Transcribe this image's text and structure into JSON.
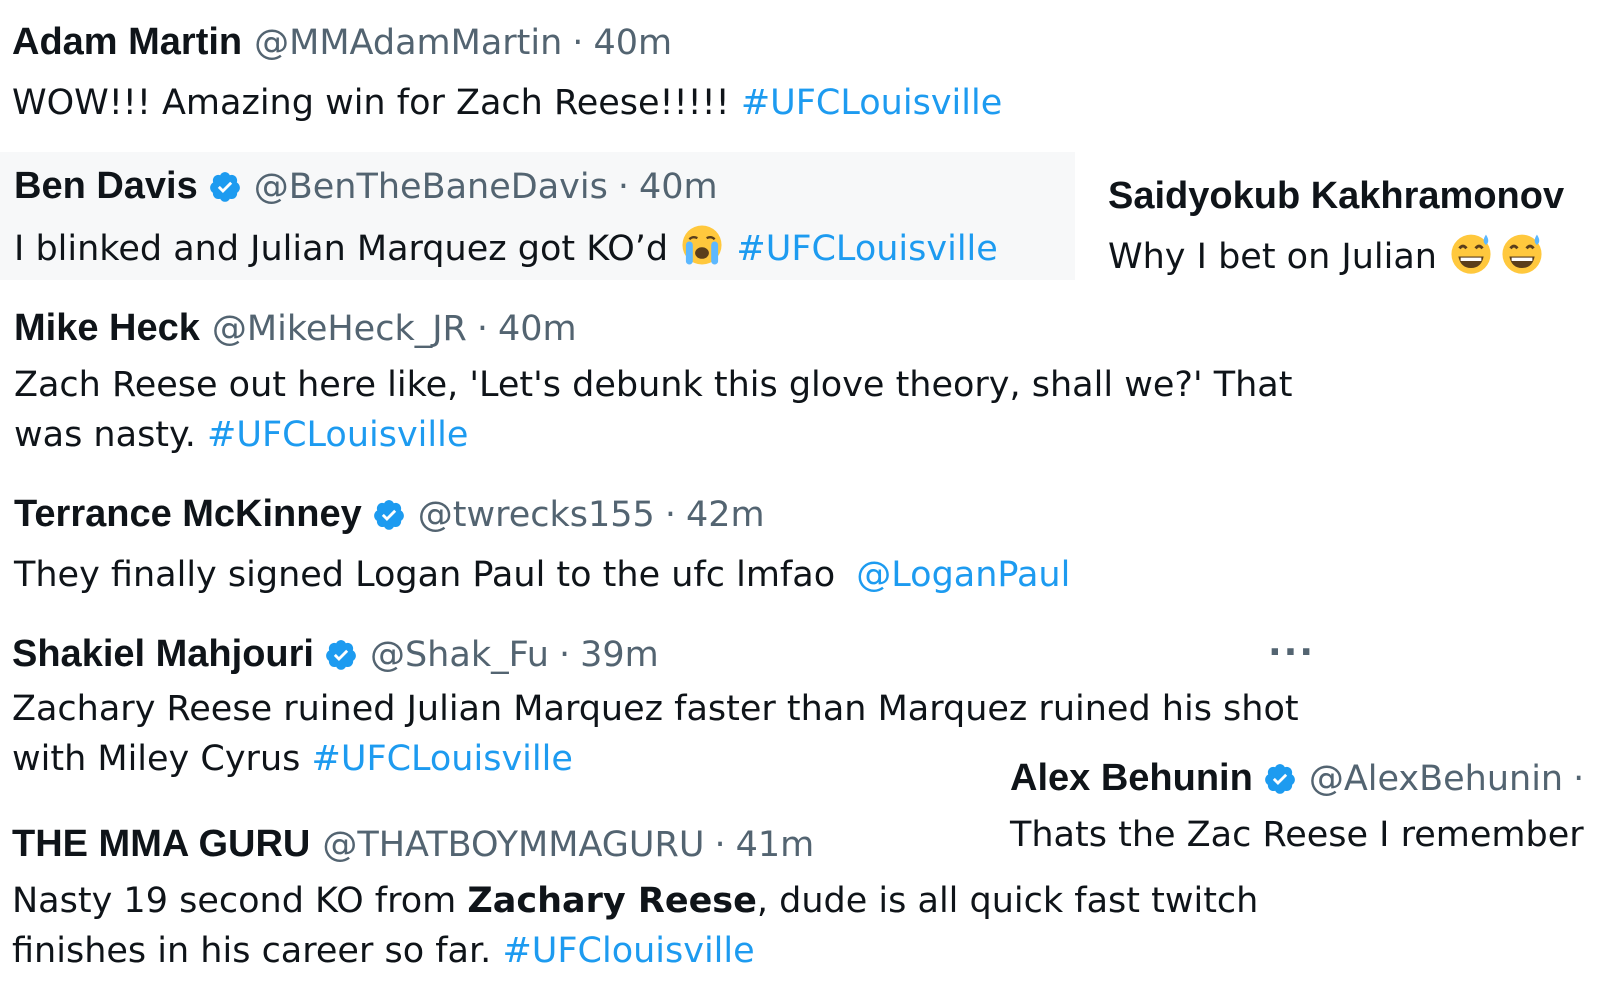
{
  "tweets": [
    {
      "name": "Adam Martin",
      "handle": "@MMAdamMartin",
      "time": "40m",
      "text": "WOW!!! Amazing win for Zach Reese!!!!!",
      "link": "#UFCLouisville"
    },
    {
      "name": "Ben Davis",
      "handle": "@BenTheBaneDavis",
      "time": "40m",
      "text": "I blinked and Julian Marquez got KO’d",
      "emoji": "loudly-crying-face-emoji",
      "link": "#UFCLouisville"
    },
    {
      "name": "Saidyokub Kakhramonov",
      "text": "Why I bet on Julian",
      "emoji": "grinning-sweat-face-emoji"
    },
    {
      "name": "Mike Heck",
      "handle": "@MikeHeck_JR",
      "time": "40m",
      "text_line1": "Zach Reese out here like, 'Let's debunk this glove theory, shall we?' That",
      "text_line2": "was nasty.",
      "link": "#UFCLouisville"
    },
    {
      "name": "Terrance McKinney",
      "handle": "@twrecks155",
      "time": "42m",
      "text": "They finally signed Logan Paul to the ufc lmfao",
      "link": "@LoganPaul"
    },
    {
      "name": "Shakiel Mahjouri",
      "handle": "@Shak_Fu",
      "time": "39m",
      "text_line1": "Zachary Reese ruined Julian Marquez faster than Marquez ruined his shot",
      "text_line2": "with Miley Cyrus",
      "link": "#UFCLouisville",
      "more": "···"
    },
    {
      "name": "Alex Behunin",
      "handle": "@AlexBehunin",
      "time_sep": "·",
      "text": "Thats the Zac Reese I remember"
    },
    {
      "name": "THE MMA GURU",
      "handle": "@THATBOYMMAGURU",
      "time": "41m",
      "text_pre": "Nasty 19 second KO from",
      "text_bold": "Zachary Reese",
      "text_post": ", dude is all quick fast twitch",
      "text_line2": "finishes in his career so far.",
      "link": "#UFClouisville"
    }
  ],
  "separator": "·",
  "colors": {
    "link": "#1d9bf0",
    "secondary": "#536471",
    "verified": "#1d9bf0"
  }
}
